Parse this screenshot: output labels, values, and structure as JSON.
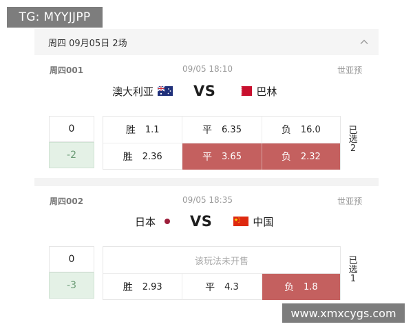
{
  "watermark_top": "TG: MYYJJPP",
  "watermark_bottom": "www.xmxcygs.com",
  "day_header": {
    "label": "周四  09月05日 2场"
  },
  "matches": [
    {
      "code": "周四001",
      "datetime": "09/05 18:10",
      "league": "世亚预",
      "home": "澳大利亚",
      "away": "巴林",
      "vs": "VS",
      "handicap_top": "0",
      "handicap_bottom": "-2",
      "row1": {
        "message": "",
        "win_label": "胜",
        "win": "1.1",
        "draw_label": "平",
        "draw": "6.35",
        "lose_label": "负",
        "lose": "16.0"
      },
      "row2": {
        "win_label": "胜",
        "win": "2.36",
        "draw_label": "平",
        "draw": "3.65",
        "lose_label": "负",
        "lose": "2.32"
      },
      "selected": {
        "line1": "已",
        "line2": "选",
        "count": "2"
      }
    },
    {
      "code": "周四002",
      "datetime": "09/05 18:35",
      "league": "世亚预",
      "home": "日本",
      "away": "中国",
      "vs": "VS",
      "handicap_top": "0",
      "handicap_bottom": "-3",
      "row1": {
        "message": "该玩法未开售"
      },
      "row2": {
        "win_label": "胜",
        "win": "2.93",
        "draw_label": "平",
        "draw": "4.3",
        "lose_label": "负",
        "lose": "1.8"
      },
      "selected": {
        "line1": "已",
        "line2": "选",
        "count": "1"
      }
    }
  ],
  "colors": {
    "selected": "#c4605f",
    "negative_handicap_bg": "#e4f1e6",
    "negative_handicap_text": "#6a9b75"
  }
}
